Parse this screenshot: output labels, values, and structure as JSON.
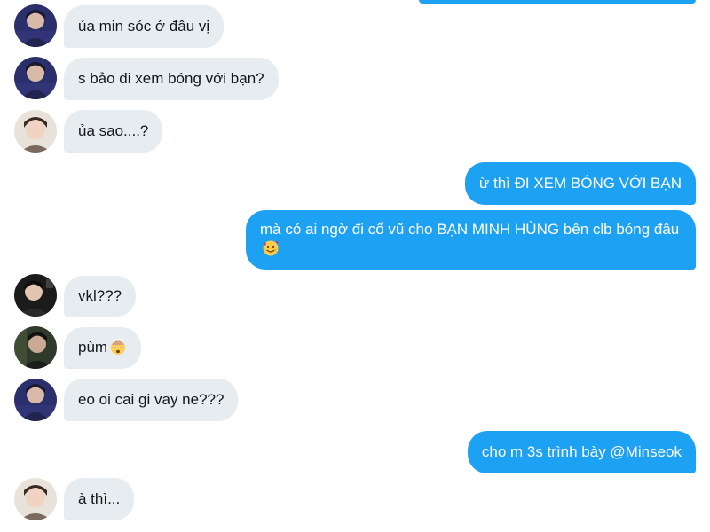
{
  "messages": [
    {
      "id": "m1",
      "side": "in",
      "text": "ủa min sóc ở đâu vị"
    },
    {
      "id": "m2",
      "side": "in",
      "text": "s bảo đi xem bóng với bạn?"
    },
    {
      "id": "m3",
      "side": "in",
      "text": "ủa sao....?"
    },
    {
      "id": "m4",
      "side": "out",
      "text": "ừ thì ĐI XEM BÓNG VỚI BẠN"
    },
    {
      "id": "m5",
      "side": "out",
      "text": "mà có ai ngờ đi cổ vũ cho BẠN MINH HÙNG bên clb bóng đâu",
      "emoji": "smiling-face-with-hearts-emoji"
    },
    {
      "id": "m6",
      "side": "in",
      "text": "vkl???"
    },
    {
      "id": "m7",
      "side": "in",
      "text": "pùm",
      "emoji": "exploding-head-emoji"
    },
    {
      "id": "m8",
      "side": "in",
      "text": "eo oi cai gi vay ne???"
    },
    {
      "id": "m9",
      "side": "out",
      "text": "cho m 3s trình bày @Minseok"
    },
    {
      "id": "m10",
      "side": "in",
      "text": "à thì..."
    }
  ],
  "colors": {
    "incoming_bubble": "#e6ecf0",
    "outgoing_bubble": "#1da1f2",
    "incoming_text": "#14171a",
    "outgoing_text": "#ffffff"
  }
}
